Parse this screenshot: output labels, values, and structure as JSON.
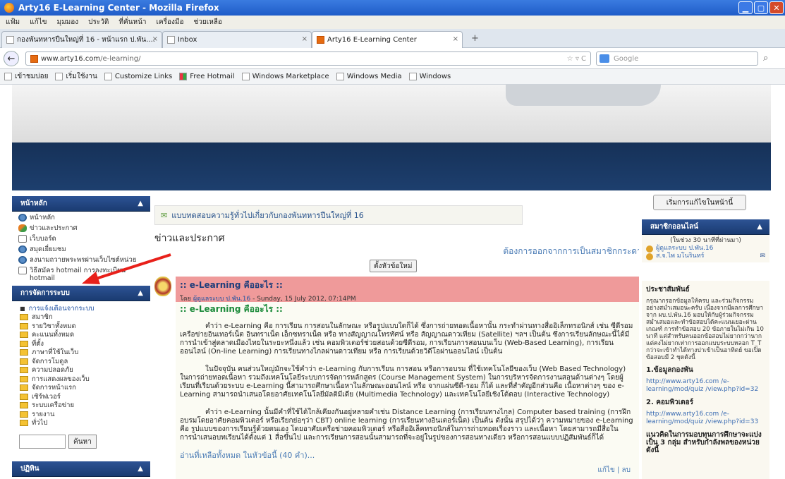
{
  "window": {
    "title": "Arty16 E-Learning Center - Mozilla Firefox"
  },
  "menu": [
    "แฟ้ม",
    "แก้ไข",
    "มุมมอง",
    "ประวัติ",
    "ที่คั่นหน้า",
    "เครื่องมือ",
    "ช่วยเหลือ"
  ],
  "tabs": [
    {
      "label": "กองพันทหารปืนใหญ่ที่ 16 - หน้าแรก ป.พัน...."
    },
    {
      "label": "Inbox"
    },
    {
      "label": "Arty16 E-Learning Center"
    }
  ],
  "url": {
    "host": "www.arty16.com",
    "path": "/e-learning/"
  },
  "search": {
    "placeholder": "Google"
  },
  "bookmarks": [
    "เข้าชมบ่อย",
    "เริ่มใช้งาน",
    "Customize Links",
    "Free Hotmail",
    "Windows Marketplace",
    "Windows Media",
    "Windows"
  ],
  "left": {
    "main_menu_title": "หน้าหลัก",
    "main_items": [
      "หน้าหลัก",
      "ข่าวและประกาศ",
      "เว็บบอร์ด",
      "สมุดเยี่ยมชม",
      "ลงนามถวายพระพรผ่านเว็บไซต์หน่วย",
      "วิธีสมัคร hotmail การลงทะเบียน hotmail"
    ],
    "admin_title": "การจัดการระบบ",
    "admin_notice": "การแจ้งเตือนจากระบบ",
    "admin_items": [
      "สมาชิก",
      "รายวิชาทั้งหมด",
      "คะแนนทั้งหมด",
      "ที่ตั้ง",
      "ภาษาที่ใช้ในเว็บ",
      "จัดการโมดูล",
      "ความปลอดภัย",
      "การแสดงผลของเว็บ",
      "จัดการหน้าแรก",
      "เซิร์ฟเวอร์",
      "ระบบเครือข่าย",
      "รายงาน",
      "ทั่วไป"
    ],
    "search_button": "ค้นหา",
    "calendar_title": "ปฏิทิน"
  },
  "main": {
    "quiz_link": "แบบทดสอบความรู้ทั่วไปเกี่ยวกับกองพันทหารปืนใหญ่ที่ 16",
    "news_heading": "ข่าวและประกาศ",
    "unsubscribe": "ต้องการออกจากการเป็นสมาชิกกระดาน",
    "add_topic": "ตั้งหัวข้อใหม่",
    "post": {
      "title": ":: e-Learning คืออะไร ::",
      "by_prefix": "โดย",
      "author": "ผู้ดูแลระบบ ป.พัน.16",
      "date": " - Sunday, 15 July 2012, 07:14PM",
      "body_heading": ":: e-Learning คืออะไร ::",
      "para1": "คำว่า e-Learning คือ การเรียน การสอนในลักษณะ หรือรูปแบบใดก็ได้ ซึ่งการถ่ายทอดเนื้อหานั้น กระทำผ่านทางสื่ออิเล็กทรอนิกส์ เช่น ซีดีรอม เครือข่ายอินเทอร์เน็ต อินทราเน็ต เอ็กซทราเน็ต หรือ ทางสัญญาณโทรทัศน์ หรือ สัญญาณดาวเทียม (Satellite) ฯลฯ เป็นต้น ซึ่งการเรียนลักษณะนี้ได้มีการนำเข้าสู่ตลาดเมืองไทยในระยะหนึ่งแล้ว เช่น คอมพิวเตอร์ช่วยสอนด้วยซีดีรอม, การเรียนการสอนบนเว็บ (Web-Based Learning), การเรียนออนไลน์ (On-line Learning) การเรียนทางไกลผ่านดาวเทียม หรือ การเรียนด้วยวิดีโอผ่านออนไลน์ เป็นต้น",
      "para2": "ในปัจจุบัน คนส่วนใหญ่มักจะใช้คำว่า e-Learning กับการเรียน การสอน หรือการอบรม ที่ใช้เทคโนโลยีของเว็บ (Web Based Technology) ในการถ่ายทอดเนื้อหา รวมถึงเทคโนโลยีระบบการจัดการหลักสูตร (Course Management System) ในการบริหารจัดการงานสอนด้านต่างๆ โดยผู้เรียนที่เรียนด้วยระบบ e-Learning นี้สามารถศึกษาเนื้อหาในลักษณะออนไลน์ หรือ จากแผ่นซีดี-รอม ก็ได้ และที่สำคัญอีกส่วนคือ เนื้อหาต่างๆ ของ e-Learning สามารถนำเสนอโดยอาศัยเทคโนโลยีมัลติมีเดีย (Multimedia Technology) และเทคโนโลยีเชิงโต้ตอบ (Interactive Technology)",
      "para3": "คำว่า e-Learning นั้นมีคำที่ใช้ได้ใกล้เคียงกันอยู่หลายคำเช่น Distance Learning (การเรียนทางไกล) Computer based training (การฝึกอบรมโดยอาศัยคอมพิวเตอร์ หรือเรียกย่อๆว่า CBT) online learning (การเรียนทางอินเตอร์เน็ต) เป็นต้น ดังนั้น สรุปได้ว่า ความหมายของ e-Learning คือ รูปแบบของการเรียนรู้ด้วยตนเอง โดยอาศัยเครือข่ายคอมพิวเตอร์ หรือสื่ออิเล็คทรอนิกส์ในการถ่ายทอดเรื่องราว และเนื้อหา โดยสามารถมีสื่อในการนำเสนอบทเรียนได้ตั้งแต่ 1 สื่อขึ้นไป และการเรียนการสอนนั้นสามารถที่จะอยู่ในรูปของการสอนทางเดียว หรือการสอนแบบปฏิสัมพันธ์ก็ได้",
      "read_more": "อ่านที่เหลือทั้งหมด ในหัวข้อนี้ (40 คำ)...",
      "edit": "แก้ไข | ลบ"
    }
  },
  "right": {
    "start_edit": "เริ่มการแก้ไขในหน้านี้",
    "online_title": "สมาชิกออนไลน์",
    "online_window": "(ในช่วง 30 นาทีที่ผ่านมา)",
    "online_users": [
      "ผู้ดูแลระบบ ป.พัน.16",
      "ส.จ.ไพ มโนรินทร์"
    ],
    "pr_title": "ประชาสัมพันธ์",
    "pr_text": "กรุณากรอกข้อมูลให้ครบ และร่วมกิจกรรมอย่างสม่ำเสมอนะครับ เนื่องจากมีผลการศึกษา จาก ผบ.ป.พัน.16 มอบให้กับผู้ร่วมกิจกรรมสม่ำเสมอและทำข้อสอบได้คะแนนเยอะผ่านเกณฑ์ การทำข้อสอบ 20 ข้อภายในไม่เกิน 10 นาที แต่สำหรับคนออกข้อสอบไม่ยากกว่านาก แต่คงไม่ยากเท่าการออกแบบระบบหลอก T_T กว่าจะเข้าทำได้ทางปาเข้าเป็นอาทิตย์ ขอเปิดข้อสอบมี 2 ชุดดังนี้",
    "item1_title": "1.ข้อมูลกองพัน",
    "item1_link": "http://www.arty16.com /e-learning/mod/quiz /view.php?id=32",
    "item2_title": "2. คอมพิวเตอร์",
    "item2_link": "http://www.arty16.com /e-learning/mod/quiz /view.php?id=33",
    "item3_title": "แนวคิดในการมอบทุนการศึกษาจะแบ่งเป็น 3 กลุ่ม สำหรับกำลังพลของหน่วยดังนี้"
  },
  "colors": {
    "title_bar": "#2a6ad8",
    "block_header": "#1f4480",
    "post_header": "#ef9a9a",
    "arrow": "#e8201a"
  }
}
